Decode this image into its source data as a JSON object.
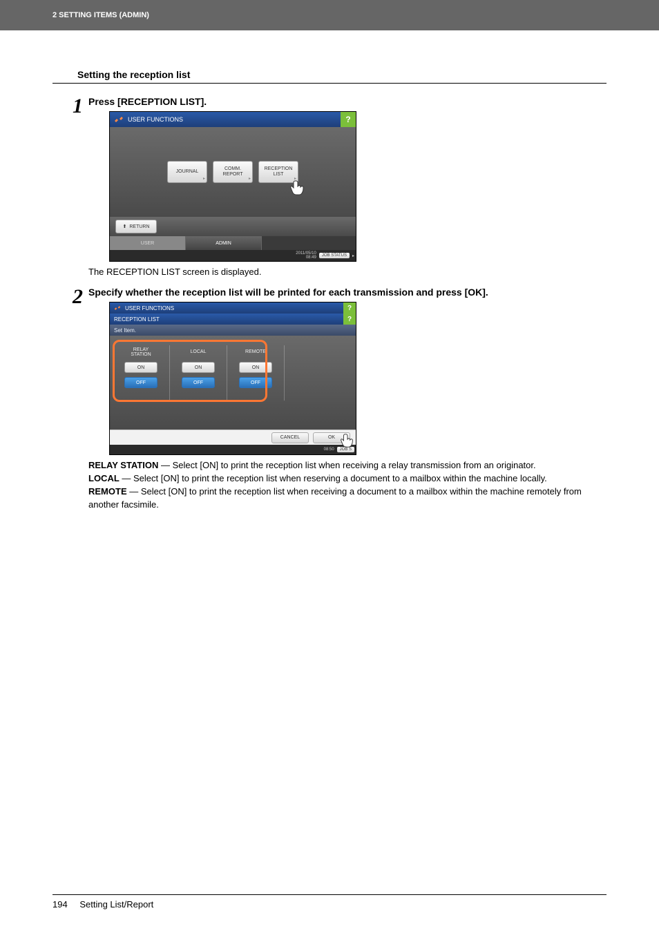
{
  "header": {
    "chapter": "2 SETTING ITEMS (ADMIN)"
  },
  "section_title": "Setting the reception list",
  "steps": {
    "s1": {
      "num": "1",
      "title": "Press [RECEPTION LIST].",
      "after_text": "The RECEPTION LIST screen is displayed."
    },
    "s2": {
      "num": "2",
      "title": "Specify whether the reception list will be printed for each transmission and press [OK]."
    }
  },
  "shot1": {
    "title": "USER FUNCTIONS",
    "help": "?",
    "buttons": {
      "journal": "JOURNAL",
      "comm": "COMM.\nREPORT",
      "reception": "RECEPTION\nLIST"
    },
    "return_label": "RETURN",
    "tabs": {
      "user": "USER",
      "admin": "ADMIN"
    },
    "date": "2011/05/10\n08:49",
    "job_status": "JOB STATUS"
  },
  "shot2": {
    "title": "USER FUNCTIONS",
    "subtitle": "RECEPTION LIST",
    "help": "?",
    "setitem": "Set Item.",
    "cols": {
      "relay": "RELAY\nSTATION",
      "local": "LOCAL",
      "remote": "REMOTE",
      "on": "ON",
      "off": "OFF"
    },
    "cancel": "CANCEL",
    "ok": "OK",
    "date": "08:50",
    "job_status": "JOB S"
  },
  "descriptions": {
    "relay_label": "RELAY STATION",
    "relay_text": " — Select [ON] to print the reception list when receiving a relay transmission from an originator.",
    "local_label": "LOCAL",
    "local_text": " — Select [ON] to print the reception list when reserving a document to a mailbox within the machine locally.",
    "remote_label": "REMOTE",
    "remote_text": " — Select [ON] to print the reception list when receiving a document to a mailbox within the machine remotely from another facsimile."
  },
  "footer": {
    "page": "194",
    "title": "Setting List/Report"
  }
}
